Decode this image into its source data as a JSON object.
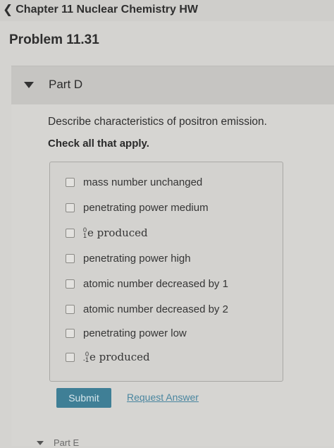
{
  "nav": {
    "back_label": "Chapter 11 Nuclear Chemistry HW"
  },
  "problem": {
    "title": "Problem 11.31"
  },
  "part": {
    "label": "Part D"
  },
  "question": {
    "text": "Describe characteristics of positron emission.",
    "instruction": "Check all that apply."
  },
  "options": [
    {
      "label": "mass number unchanged",
      "checked": false
    },
    {
      "label": "penetrating power medium",
      "checked": false
    },
    {
      "label": "e produced",
      "checked": false,
      "iso_mass": "0",
      "iso_charge": "1"
    },
    {
      "label": "penetrating power high",
      "checked": false
    },
    {
      "label": "atomic number decreased by 1",
      "checked": false
    },
    {
      "label": "atomic number decreased by 2",
      "checked": false
    },
    {
      "label": "penetrating power low",
      "checked": false
    },
    {
      "label": "e produced",
      "checked": false,
      "iso_mass": "0",
      "iso_charge": "-1"
    }
  ],
  "actions": {
    "submit_label": "Submit",
    "request_answer_label": "Request Answer"
  },
  "next_part": {
    "label": "Part E"
  }
}
